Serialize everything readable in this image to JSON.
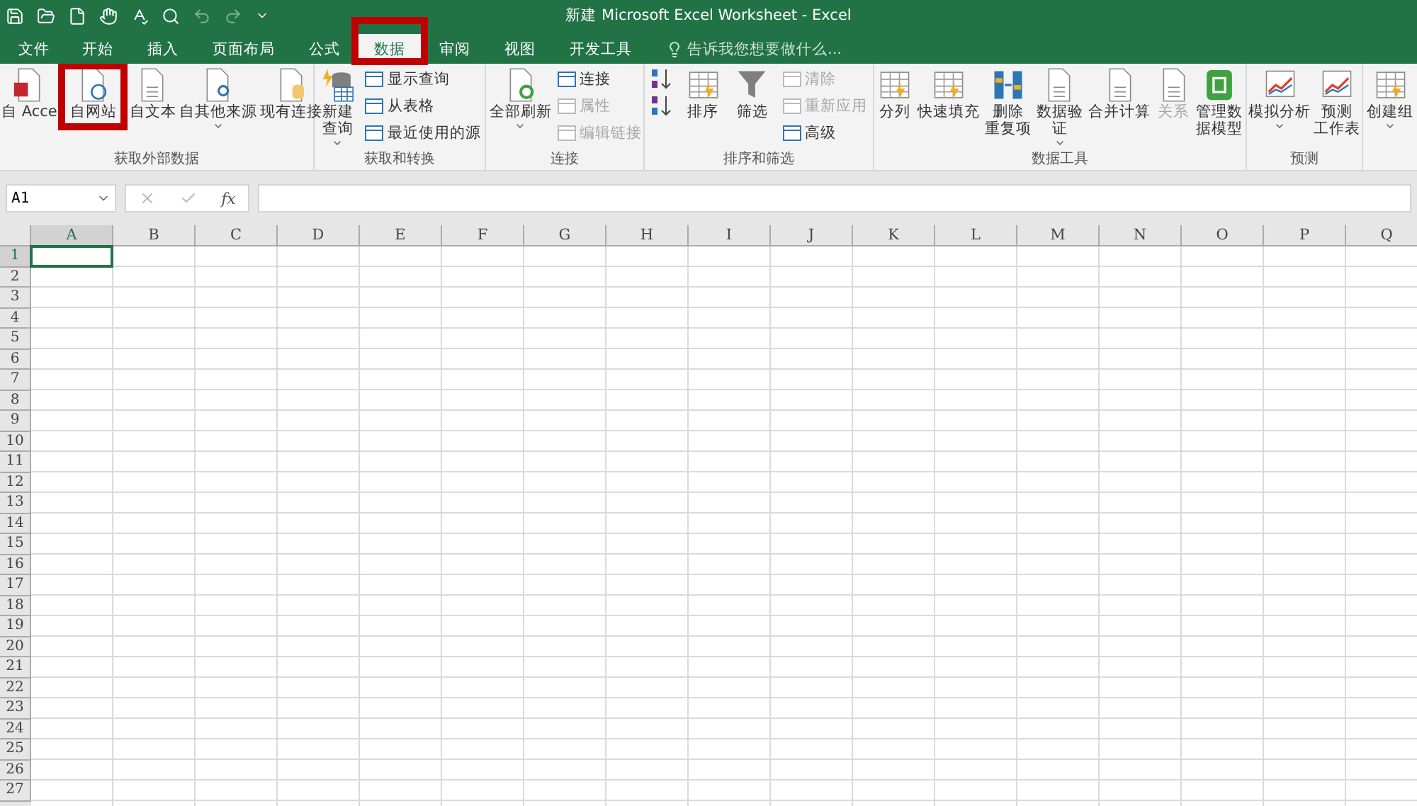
{
  "window": {
    "title": "新建 Microsoft Excel Worksheet - Excel"
  },
  "tabs": [
    {
      "label": "文件",
      "selected": false
    },
    {
      "label": "开始",
      "selected": false
    },
    {
      "label": "插入",
      "selected": false
    },
    {
      "label": "页面布局",
      "selected": false
    },
    {
      "label": "公式",
      "selected": false
    },
    {
      "label": "数据",
      "selected": true,
      "highlighted": true
    },
    {
      "label": "审阅",
      "selected": false
    },
    {
      "label": "视图",
      "selected": false
    },
    {
      "label": "开发工具",
      "selected": false
    }
  ],
  "tell_me": {
    "placeholder": "告诉我您想要做什么..."
  },
  "ribbon": {
    "groups": [
      {
        "label": "获取外部数据",
        "controls": [
          {
            "kind": "large",
            "label": [
              "自 Acce"
            ],
            "disabled": false
          },
          {
            "kind": "large",
            "label": [
              "自网站"
            ],
            "disabled": false,
            "highlighted": true
          },
          {
            "kind": "large",
            "label": [
              "自文本"
            ],
            "disabled": false
          },
          {
            "kind": "large",
            "label": [
              "自其他来源"
            ],
            "disabled": false,
            "dropdown": true
          },
          {
            "kind": "large",
            "label": [
              "现有连接"
            ],
            "disabled": false
          }
        ]
      },
      {
        "label": "获取和转换",
        "controls": [
          {
            "kind": "large",
            "label": [
              "新建",
              "查询"
            ],
            "disabled": false,
            "dropdown": true
          },
          {
            "kind": "small",
            "label": [
              "显示查询"
            ],
            "disabled": false
          },
          {
            "kind": "small",
            "label": [
              "从表格"
            ],
            "disabled": false
          },
          {
            "kind": "small",
            "label": [
              "最近使用的源"
            ],
            "disabled": false
          }
        ]
      },
      {
        "label": "连接",
        "controls": [
          {
            "kind": "large",
            "label": [
              "全部刷新"
            ],
            "disabled": false,
            "dropdown": true
          },
          {
            "kind": "small",
            "label": [
              "连接"
            ],
            "disabled": false
          },
          {
            "kind": "small",
            "label": [
              "属性"
            ],
            "disabled": true
          },
          {
            "kind": "small",
            "label": [
              "编辑链接"
            ],
            "disabled": true
          }
        ]
      },
      {
        "label": "排序和筛选",
        "controls": [
          {
            "kind": "sort"
          },
          {
            "kind": "sort"
          },
          {
            "kind": "large",
            "label": [
              "排序"
            ],
            "disabled": false
          },
          {
            "kind": "large",
            "label": [
              "筛选"
            ],
            "disabled": false
          },
          {
            "kind": "small",
            "label": [
              "清除"
            ],
            "disabled": true
          },
          {
            "kind": "small",
            "label": [
              "重新应用"
            ],
            "disabled": true
          },
          {
            "kind": "small",
            "label": [
              "高级"
            ],
            "disabled": false
          }
        ]
      },
      {
        "label": "数据工具",
        "controls": [
          {
            "kind": "large",
            "label": [
              "分列"
            ],
            "disabled": false
          },
          {
            "kind": "large",
            "label": [
              "快速填充"
            ],
            "disabled": false
          },
          {
            "kind": "large",
            "label": [
              "删除",
              "重复项"
            ],
            "disabled": false
          },
          {
            "kind": "large",
            "label": [
              "数据验",
              "证"
            ],
            "disabled": false,
            "dropdown": true
          },
          {
            "kind": "large",
            "label": [
              "合并计算"
            ],
            "disabled": false
          },
          {
            "kind": "large",
            "label": [
              "关系"
            ],
            "disabled": true
          },
          {
            "kind": "large",
            "label": [
              "管理数",
              "据模型"
            ],
            "disabled": false
          }
        ]
      },
      {
        "label": "预测",
        "controls": [
          {
            "kind": "large",
            "label": [
              "模拟分析"
            ],
            "disabled": false,
            "dropdown": true
          },
          {
            "kind": "large",
            "label": [
              "预测",
              "工作表"
            ],
            "disabled": false
          }
        ]
      },
      {
        "controls": [
          {
            "kind": "large",
            "label": [
              "创建组"
            ],
            "disabled": false,
            "dropdown": true
          }
        ]
      }
    ]
  },
  "formula_bar": {
    "name_box": "A1",
    "function_button": "fx"
  },
  "sheet": {
    "columns": [
      {
        "label": "A",
        "selected": true
      },
      {
        "label": "B",
        "selected": false
      },
      {
        "label": "C",
        "selected": false
      },
      {
        "label": "D",
        "selected": false
      },
      {
        "label": "E",
        "selected": false
      },
      {
        "label": "F",
        "selected": false
      },
      {
        "label": "G",
        "selected": false
      },
      {
        "label": "H",
        "selected": false
      },
      {
        "label": "I",
        "selected": false
      },
      {
        "label": "J",
        "selected": false
      },
      {
        "label": "K",
        "selected": false
      },
      {
        "label": "L",
        "selected": false
      },
      {
        "label": "M",
        "selected": false
      },
      {
        "label": "N",
        "selected": false
      },
      {
        "label": "O",
        "selected": false
      },
      {
        "label": "P",
        "selected": false
      },
      {
        "label": "Q",
        "selected": false
      }
    ],
    "rows": [
      {
        "label": "1",
        "selected": true
      },
      {
        "label": "2",
        "selected": false
      },
      {
        "label": "3",
        "selected": false
      },
      {
        "label": "4",
        "selected": false
      },
      {
        "label": "5",
        "selected": false
      },
      {
        "label": "6",
        "selected": false
      },
      {
        "label": "7",
        "selected": false
      },
      {
        "label": "8",
        "selected": false
      },
      {
        "label": "9",
        "selected": false
      },
      {
        "label": "10",
        "selected": false
      },
      {
        "label": "11",
        "selected": false
      },
      {
        "label": "12",
        "selected": false
      },
      {
        "label": "13",
        "selected": false
      },
      {
        "label": "14",
        "selected": false
      },
      {
        "label": "15",
        "selected": false
      },
      {
        "label": "16",
        "selected": false
      },
      {
        "label": "17",
        "selected": false
      },
      {
        "label": "18",
        "selected": false
      },
      {
        "label": "19",
        "selected": false
      },
      {
        "label": "20",
        "selected": false
      },
      {
        "label": "21",
        "selected": false
      },
      {
        "label": "22",
        "selected": false
      },
      {
        "label": "23",
        "selected": false
      },
      {
        "label": "24",
        "selected": false
      },
      {
        "label": "25",
        "selected": false
      },
      {
        "label": "26",
        "selected": false
      },
      {
        "label": "27",
        "selected": false
      }
    ]
  }
}
